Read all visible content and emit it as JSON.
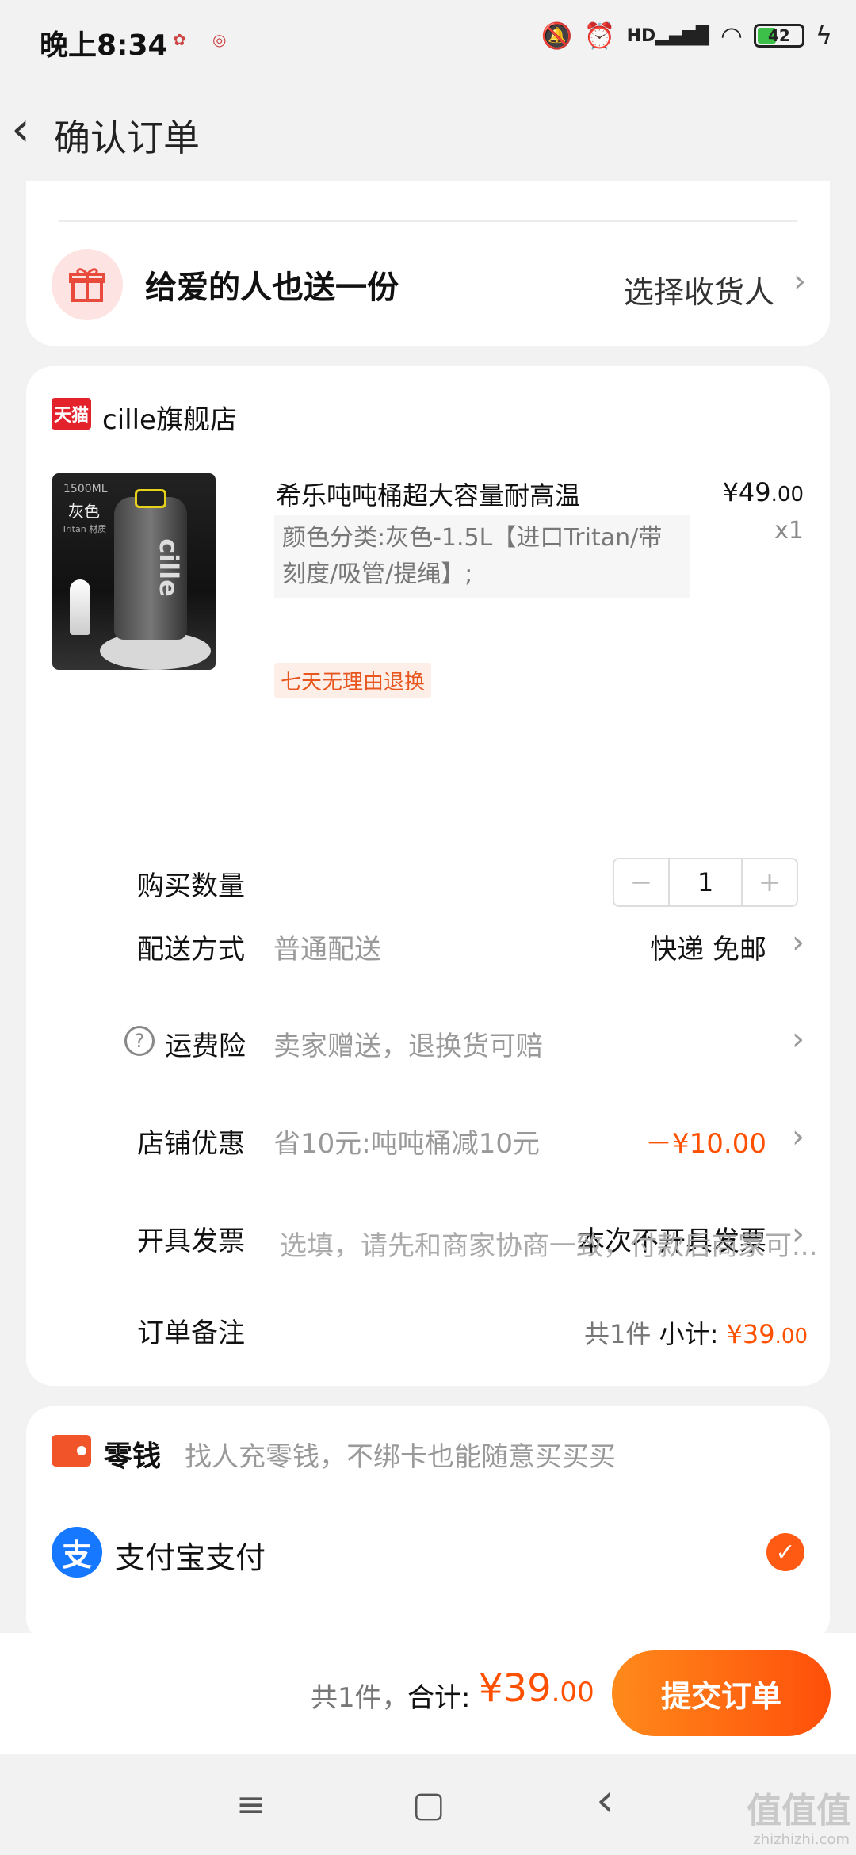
{
  "status_bar": {
    "time": "晚上8:34",
    "hd": "HD",
    "battery": "42"
  },
  "header": {
    "back_icon": "‹",
    "title": "确认订单"
  },
  "gift": {
    "title": "给爱的人也送一份",
    "link": "选择收货人"
  },
  "store": {
    "logo": "天猫",
    "name": "cille旗舰店"
  },
  "product": {
    "image_text_ml": "1500ML",
    "image_text_color": "灰色",
    "image_text_tritan": "Tritan 材质",
    "image_text_brand": "cille",
    "name": "希乐吨吨桶超大容量耐高温",
    "price_main": "¥49",
    "price_dec": ".00",
    "qty": "x1",
    "spec": "颜色分类:灰色-1.5L【进口Tritan/带刻度/吸管/提绳】;",
    "badge": "七天无理由退换"
  },
  "rows": {
    "quantity": {
      "label": "购买数量",
      "minus": "−",
      "value": "1",
      "plus": "+"
    },
    "delivery": {
      "label": "配送方式",
      "value": "普通配送",
      "right": "快递 免邮"
    },
    "insurance": {
      "label": "运费险",
      "value": "卖家赠送，退换货可赔",
      "icon": "?"
    },
    "discount": {
      "label": "店铺优惠",
      "value": "省10元:吨吨桶减10元",
      "right": "－¥10.00"
    },
    "invoice": {
      "label": "开具发票",
      "right": "本次不开具发票"
    },
    "note": {
      "label": "订单备注",
      "placeholder": "选填，请先和商家协商一致，付款后商家可..."
    }
  },
  "subtotal": {
    "count": "共1件",
    "label": "小计:",
    "amount_main": "¥39",
    "amount_dec": ".00"
  },
  "payment": {
    "wallet_title": "零钱",
    "wallet_desc": "找人充零钱，不绑卡也能随意买买买",
    "alipay_icon": "支",
    "alipay_title": "支付宝支付",
    "selected": true
  },
  "bottom": {
    "count": "共1件，",
    "total_label": "合计:",
    "amount_main": "¥39",
    "amount_dec": ".00",
    "submit": "提交订单"
  },
  "nav": {
    "menu": "≡",
    "home": "▢",
    "back": "‹"
  },
  "watermark": {
    "main": "值值值",
    "sub": "zhizhizhi.com"
  },
  "colors": {
    "accent": "#ff5000",
    "alipay": "#1677ff",
    "tmall": "#e3222b"
  }
}
